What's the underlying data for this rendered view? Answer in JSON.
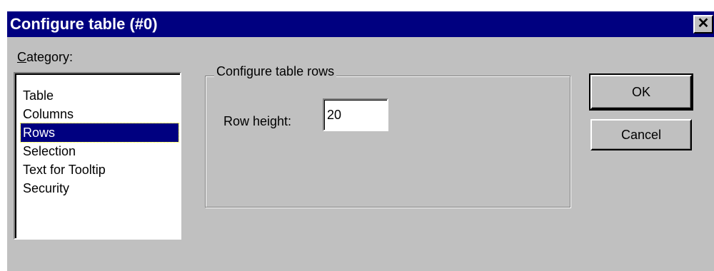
{
  "window": {
    "title": "Configure table (#0)",
    "close_glyph": "✕"
  },
  "category": {
    "label_accel": "C",
    "label_rest": "ategory:",
    "items": [
      {
        "label": "Table",
        "selected": false
      },
      {
        "label": "Columns",
        "selected": false
      },
      {
        "label": "Rows",
        "selected": true
      },
      {
        "label": "Selection",
        "selected": false
      },
      {
        "label": "Text for Tooltip",
        "selected": false
      },
      {
        "label": "Security",
        "selected": false
      }
    ]
  },
  "rows_group": {
    "title": "Configure table rows",
    "row_height_label": "Row height:",
    "row_height_value": "20"
  },
  "buttons": {
    "ok_label": "OK",
    "cancel_label": "Cancel"
  },
  "colors": {
    "titlebar": "#000080",
    "dialog_face": "#c0c0c0",
    "selection": "#000080"
  },
  "icons": {
    "close": "close-icon"
  }
}
